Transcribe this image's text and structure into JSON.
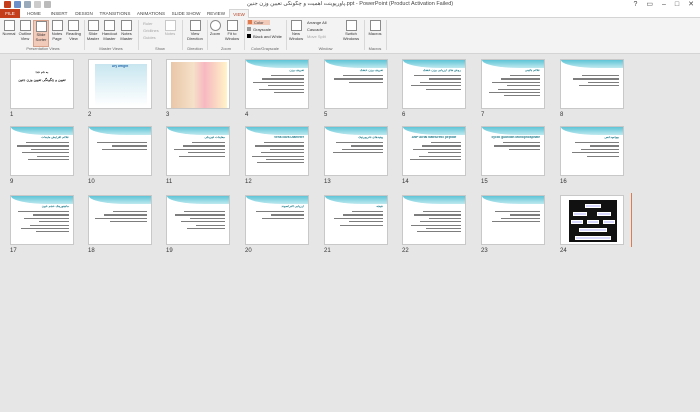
{
  "window": {
    "title": "پاورپوینت اهمیت و چگونگی تعیین وزن جنین.ppt - PowerPoint (Product Activation Failed)",
    "controls": [
      "?",
      "▭",
      "–",
      "□",
      "✕"
    ]
  },
  "tabs": [
    "FILE",
    "HOME",
    "INSERT",
    "DESIGN",
    "TRANSITIONS",
    "ANIMATIONS",
    "SLIDE SHOW",
    "REVIEW",
    "VIEW"
  ],
  "active_tab": "VIEW",
  "ribbon": {
    "presentation_views": {
      "label": "Presentation Views",
      "buttons": [
        "Normal",
        "Outline View",
        "Slide Sorter",
        "Notes Page",
        "Reading View"
      ]
    },
    "master_views": {
      "label": "Master Views",
      "buttons": [
        "Slide Master",
        "Handout Master",
        "Notes Master"
      ]
    },
    "show": {
      "label": "Show",
      "items": [
        "Ruler",
        "Gridlines",
        "Guides"
      ]
    },
    "notes_button": "Notes",
    "direction": {
      "label": "Direction",
      "button": "View Direction"
    },
    "zoom": {
      "label": "Zoom",
      "buttons": [
        "Zoom",
        "Fit to Window"
      ]
    },
    "color": {
      "label": "Color/Grayscale",
      "items": [
        "Color",
        "Grayscale",
        "Black and White"
      ]
    },
    "window": {
      "label": "Window",
      "new_window": "New Window",
      "items": [
        "Arrange All",
        "Cascade",
        "Move Split"
      ]
    },
    "switch_windows": "Switch Windows",
    "macros": {
      "label": "Macros",
      "button": "Macros"
    }
  },
  "slides": [
    {
      "n": "1",
      "title": "به نام خدا",
      "body": "تعیین و چگونگی تعیین وزن جنین"
    },
    {
      "n": "2",
      "title": "Dry weight"
    },
    {
      "n": "3",
      "title": ""
    },
    {
      "n": "4",
      "title": "تعریف وزن"
    },
    {
      "n": "5",
      "title": "تعریف وزن خشک"
    },
    {
      "n": "6",
      "title": "روش های ارزیابی وزن خشک"
    },
    {
      "n": "7",
      "title": "علائم بالینی"
    },
    {
      "n": "8",
      "title": ""
    },
    {
      "n": "9",
      "title": "علائم افزایش مایعات"
    },
    {
      "n": "10",
      "title": ""
    },
    {
      "n": "11",
      "title": "معاینات فیزیکی"
    },
    {
      "n": "12",
      "title": "vena cava Diameter"
    },
    {
      "n": "13",
      "title": "پیتیدهای ناتریورتیک"
    },
    {
      "n": "14",
      "title": "ANP  Atrial Natriuretic peptide"
    },
    {
      "n": "15",
      "title": "cyclic guanidin Monophosphate"
    },
    {
      "n": "16",
      "title": "بیوامپدانس"
    },
    {
      "n": "17",
      "title": "مانیتورینگ حجم خون"
    },
    {
      "n": "18",
      "title": ""
    },
    {
      "n": "19",
      "title": ""
    },
    {
      "n": "20",
      "title": "ارزیابی آلتراسوند"
    },
    {
      "n": "21",
      "title": "نتیجه"
    },
    {
      "n": "22",
      "title": ""
    },
    {
      "n": "23",
      "title": ""
    },
    {
      "n": "24",
      "title": ""
    }
  ],
  "colors": {
    "file_tab": "#c43e1c",
    "accent": "#b7472a",
    "wave": "#5ec4d6"
  }
}
